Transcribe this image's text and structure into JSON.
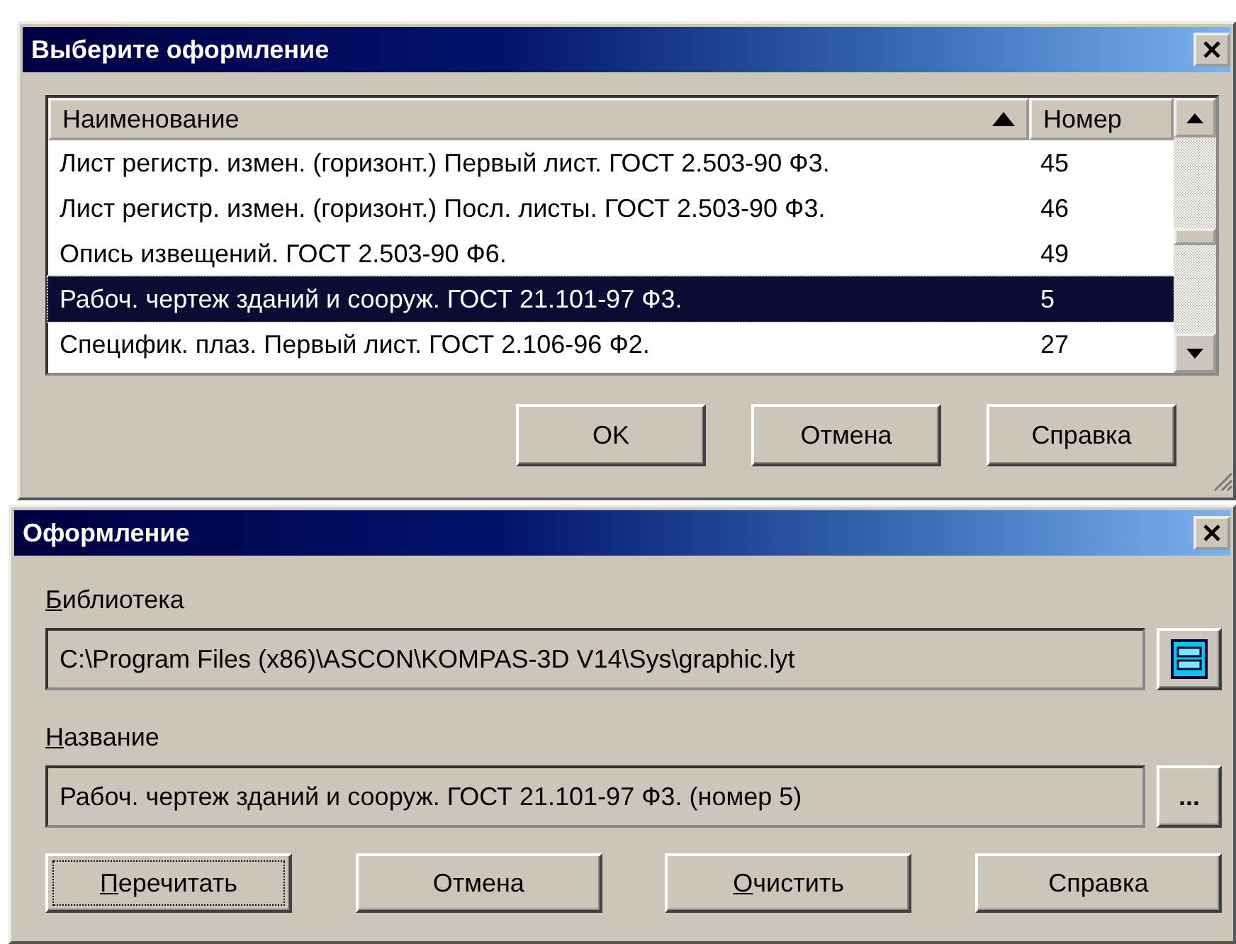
{
  "select_dialog": {
    "title": "Выберите оформление",
    "columns": [
      {
        "label": "Наименование",
        "sorted": true
      },
      {
        "label": "Номер",
        "sorted": false
      }
    ],
    "rows": [
      {
        "name": "Лист регистр. измен. (горизонт.) Первый лист. ГОСТ 2.503-90 Ф3.",
        "number": "45",
        "selected": false
      },
      {
        "name": "Лист регистр. измен. (горизонт.) Посл. листы. ГОСТ 2.503-90 Ф3.",
        "number": "46",
        "selected": false
      },
      {
        "name": "Опись извещений. ГОСТ 2.503-90 Ф6.",
        "number": "49",
        "selected": false
      },
      {
        "name": "Рабоч. чертеж зданий и сооруж. ГОСТ 21.101-97 Ф3.",
        "number": "5",
        "selected": true
      },
      {
        "name": "Специфик. плаз. Первый лист. ГОСТ 2.106-96 Ф2.",
        "number": "27",
        "selected": false
      }
    ],
    "buttons": [
      {
        "label": "OK",
        "focused": false
      },
      {
        "label": "Отмена",
        "focused": false
      },
      {
        "label": "Справка",
        "focused": false
      }
    ]
  },
  "layout_dialog": {
    "title": "Оформление",
    "fields": [
      {
        "label": "Библиотека",
        "mnemonic": true,
        "value": "C:\\Program Files (x86)\\ASCON\\KOMPAS-3D V14\\Sys\\graphic.lyt",
        "kind": "library"
      },
      {
        "label": "Название",
        "mnemonic": true,
        "value": "Рабоч. чертеж зданий и сооруж. ГОСТ 21.101-97 Ф3. (номер 5)",
        "kind": "browse",
        "button": "..."
      }
    ],
    "buttons": [
      {
        "label": "Перечитать",
        "mnemonic": true,
        "focused": true
      },
      {
        "label": "Отмена",
        "mnemonic": false,
        "focused": false
      },
      {
        "label": "Очистить",
        "mnemonic": true,
        "focused": false
      },
      {
        "label": "Справка",
        "mnemonic": false,
        "focused": false
      }
    ]
  }
}
